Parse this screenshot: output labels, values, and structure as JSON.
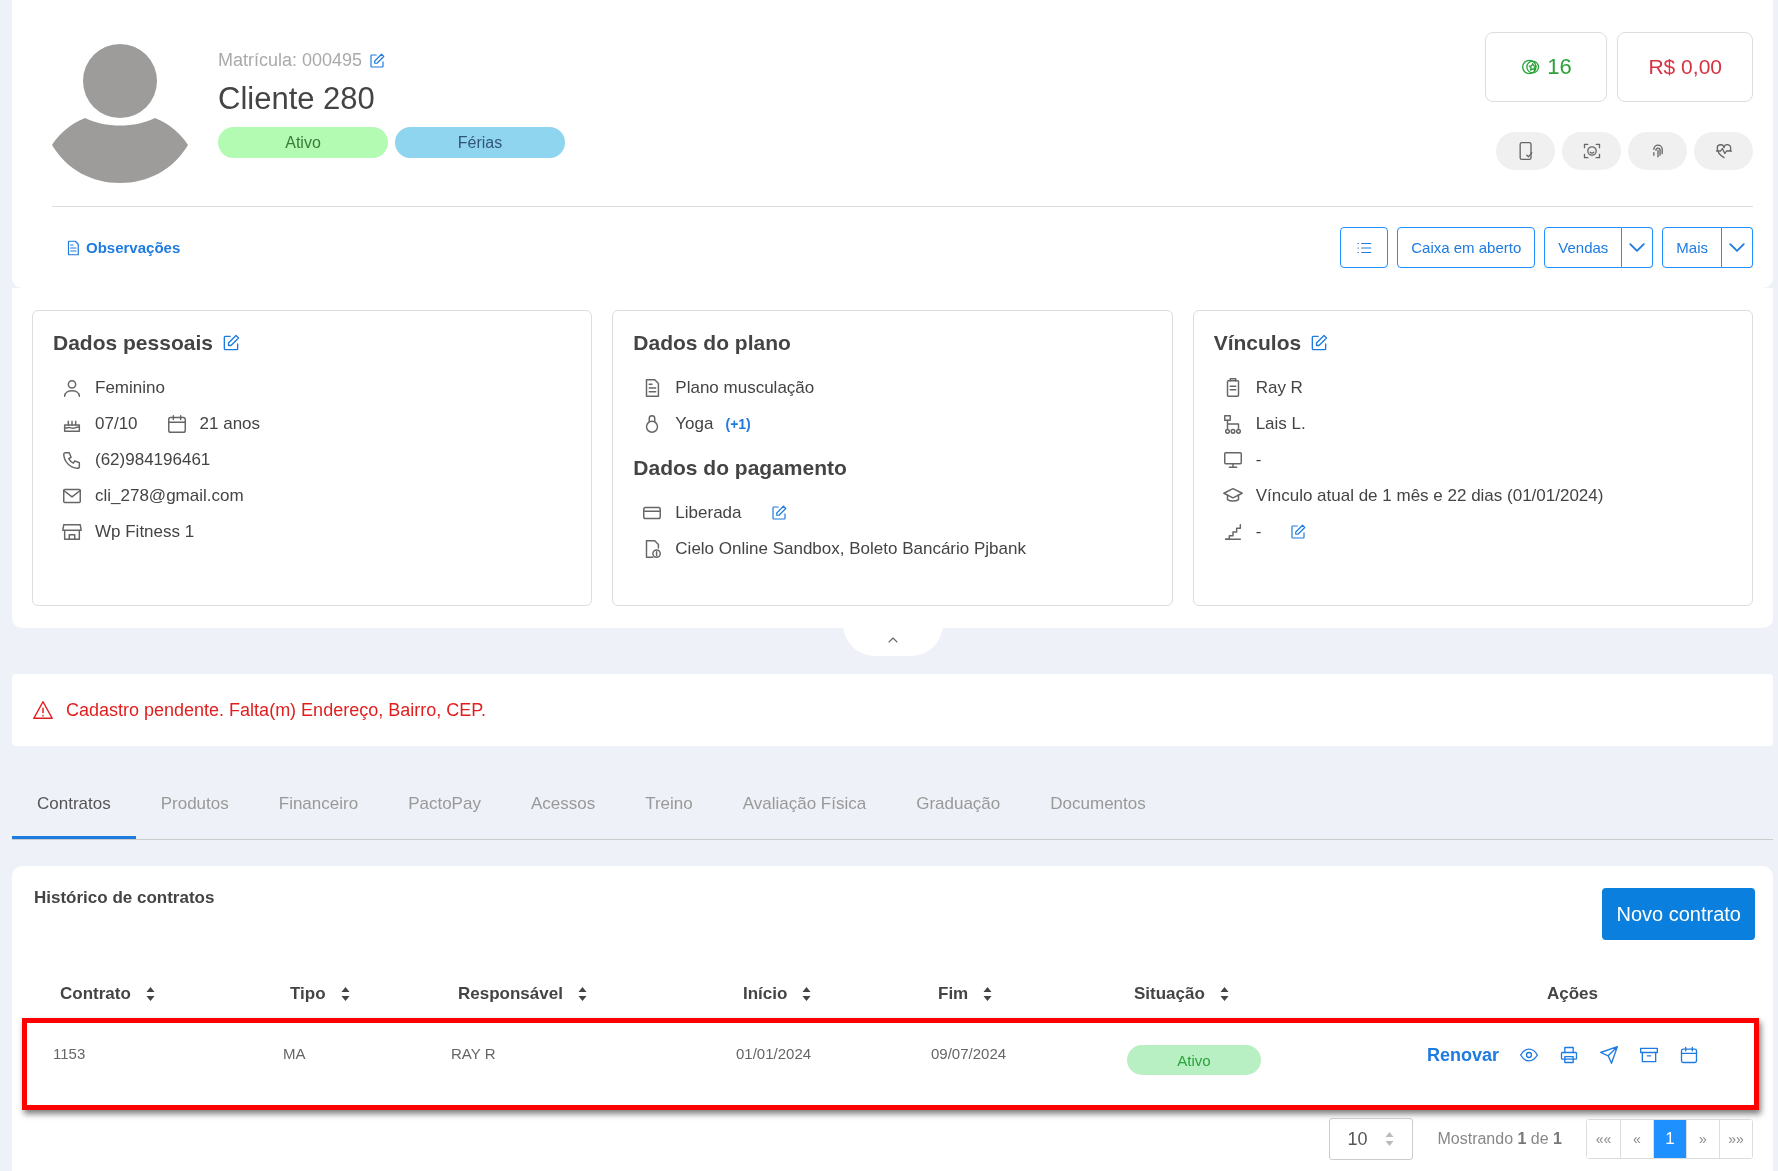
{
  "profile": {
    "registration_label": "Matrícula: 000495",
    "name": "Cliente 280",
    "tags": [
      {
        "text": "Ativo",
        "color": "#b3fab2"
      },
      {
        "text": "Férias",
        "color": "#8fd5ef"
      }
    ],
    "points": "16",
    "balance": "R$ 0,00",
    "notes_link": "Observações"
  },
  "toolbar": {
    "buttons": [
      {
        "label": "Caixa em aberto",
        "dropdown": false
      },
      {
        "label": "Vendas",
        "dropdown": true
      },
      {
        "label": "Mais",
        "dropdown": true
      }
    ]
  },
  "cards": [
    {
      "groups": [
        {
          "title": "Dados pessoais",
          "editable": true,
          "rows": [
            {
              "items": [
                "Feminino"
              ]
            },
            {
              "items": [
                "07/10",
                "21 anos"
              ]
            },
            {
              "items": [
                "(62)984196461"
              ]
            },
            {
              "items": [
                "cli_278@gmail.com"
              ]
            },
            {
              "items": [
                "Wp Fitness 1"
              ]
            }
          ]
        }
      ]
    },
    {
      "groups": [
        {
          "title": "Dados do plano",
          "editable": false,
          "rows": [
            {
              "items": [
                "Plano musculação"
              ]
            },
            {
              "items": [
                "Yoga"
              ],
              "link": "(+1)"
            }
          ]
        },
        {
          "title": "Dados do pagamento",
          "editable": false,
          "rows": [
            {
              "items": [
                "Liberada"
              ],
              "editable": true
            },
            {
              "items": [
                "Cielo Online Sandbox, Boleto Bancário Pjbank"
              ]
            }
          ]
        }
      ]
    },
    {
      "groups": [
        {
          "title": "Vínculos",
          "editable": true,
          "rows": [
            {
              "items": [
                "Ray R"
              ]
            },
            {
              "items": [
                "Lais L."
              ]
            },
            {
              "items": [
                "-"
              ]
            },
            {
              "items": [
                "Vínculo atual de 1 mês e 22 dias (01/01/2024)"
              ]
            },
            {
              "items": [
                "-"
              ],
              "editable": true
            }
          ]
        }
      ]
    }
  ],
  "alert": "Cadastro pendente. Falta(m) Endereço, Bairro, CEP.",
  "tabs": [
    {
      "label": "Contratos",
      "selected": true
    },
    {
      "label": "Produtos",
      "selected": false
    },
    {
      "label": "Financeiro",
      "selected": false
    },
    {
      "label": "PactoPay",
      "selected": false
    },
    {
      "label": "Acessos",
      "selected": false
    },
    {
      "label": "Treino",
      "selected": false
    },
    {
      "label": "Avaliação Física",
      "selected": false
    },
    {
      "label": "Graduação",
      "selected": false
    },
    {
      "label": "Documentos",
      "selected": false
    }
  ],
  "contracts": {
    "title": "Histórico de contratos",
    "new_button": "Novo contrato",
    "columns": [
      {
        "label": "Contrato",
        "sortable": true
      },
      {
        "label": "Tipo",
        "sortable": true
      },
      {
        "label": "Responsável",
        "sortable": true
      },
      {
        "label": "Início",
        "sortable": true
      },
      {
        "label": "Fim",
        "sortable": true
      },
      {
        "label": "Situação",
        "sortable": true
      },
      {
        "label": "Ações",
        "sortable": false
      }
    ],
    "rows": [
      {
        "cells": [
          "1153",
          "MA",
          "RAY R",
          "01/01/2024",
          "09/07/2024"
        ],
        "status": "Ativo",
        "action": "Renovar",
        "highlighted": true
      }
    ],
    "page_size": "10",
    "showing": "Mostrando **1** de **1**",
    "pages": [
      {
        "label": "««",
        "selected": false
      },
      {
        "label": "«",
        "selected": false
      },
      {
        "label": "1",
        "selected": true
      },
      {
        "label": "»",
        "selected": false
      },
      {
        "label": "»»",
        "selected": false
      }
    ]
  }
}
